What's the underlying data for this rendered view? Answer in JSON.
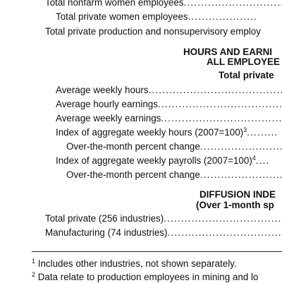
{
  "top_rows": [
    {
      "label": "Total nonfarm women employees",
      "dots": "............................."
    },
    {
      "label": "Total private women employees",
      "dots": "...................."
    },
    {
      "label": "Total private production and nonsupervisory employ",
      "dots": ""
    }
  ],
  "section_hours": {
    "title_line1": "HOURS AND EARNI",
    "title_line2": "ALL EMPLOYEE",
    "subtitle": "Total private"
  },
  "hours_rows": [
    {
      "label": "Average weekly hours",
      "sup": "",
      "dots": "........................................"
    },
    {
      "label": "Average hourly earnings",
      "sup": "",
      "dots": "......................................"
    },
    {
      "label": "Average weekly earnings",
      "sup": "",
      "dots": "........................................"
    },
    {
      "label": "Index of aggregate weekly hours (2007=100)",
      "sup": "3",
      "dots": "........."
    },
    {
      "label": "Over-the-month percent change",
      "sup": "",
      "dots": "........................"
    },
    {
      "label": "Index of aggregate weekly payrolls (2007=100)",
      "sup": "4",
      "dots": "...."
    },
    {
      "label": "Over-the-month percent change",
      "sup": "",
      "dots": "........................"
    }
  ],
  "section_diffusion": {
    "title_line1": "DIFFUSION INDE",
    "title_line2": "(Over 1-month sp"
  },
  "diffusion_rows": [
    {
      "label": "Total private (256 industries)",
      "dots": "..................................."
    },
    {
      "label": "Manufacturing (74 industries)",
      "dots": "..................................."
    }
  ],
  "footnotes": [
    {
      "mark": "1",
      "text": "Includes other industries, not shown separately."
    },
    {
      "mark": "2",
      "text": "Data relate to production employees in mining and lo"
    }
  ]
}
